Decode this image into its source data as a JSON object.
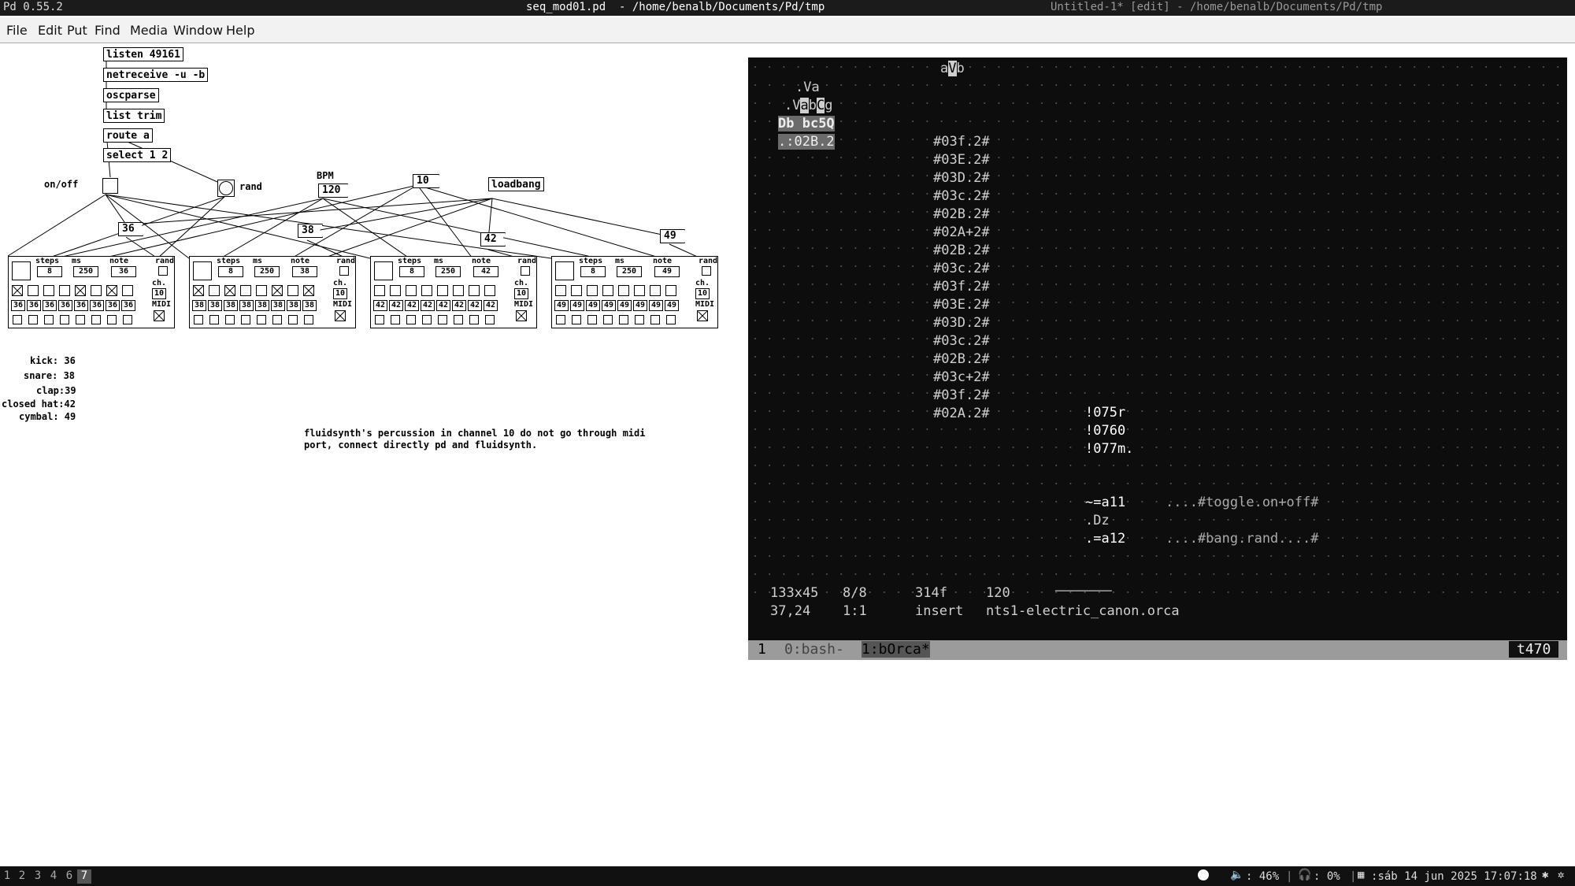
{
  "window": {
    "pd_version": "Pd 0.55.2",
    "active_title": "seq_mod01.pd  - /home/benalb/Documents/Pd/tmp",
    "other_title": "Untitled-1* [edit] - /home/benalb/Documents/Pd/tmp"
  },
  "menu": [
    "File",
    "Edit",
    "Put",
    "Find",
    "Media",
    "Window",
    "Help"
  ],
  "patch": {
    "chain": [
      "listen 49161",
      "netreceive -u -b",
      "oscparse",
      "list trim",
      "route a",
      "select 1 2"
    ],
    "onoff_label": "on/off",
    "rand_label": "rand",
    "bpm_label": "BPM",
    "bpm_value": "120",
    "msg_10": "10",
    "loadbang": "loadbang",
    "note_msgs": [
      "36",
      "38",
      "42",
      "49"
    ],
    "sequencers": [
      {
        "note": "36",
        "steps": "8",
        "ms": "250",
        "ch": "10",
        "notes": [
          "36",
          "36",
          "36",
          "36",
          "36",
          "36",
          "36",
          "36"
        ]
      },
      {
        "note": "38",
        "steps": "8",
        "ms": "250",
        "ch": "10",
        "notes": [
          "38",
          "38",
          "38",
          "38",
          "38",
          "38",
          "38",
          "38"
        ]
      },
      {
        "note": "42",
        "steps": "8",
        "ms": "250",
        "ch": "10",
        "notes": [
          "42",
          "42",
          "42",
          "42",
          "42",
          "42",
          "42",
          "42"
        ]
      },
      {
        "note": "49",
        "steps": "8",
        "ms": "250",
        "ch": "10",
        "notes": [
          "49",
          "49",
          "49",
          "49",
          "49",
          "49",
          "49",
          "49"
        ]
      }
    ],
    "seq_labels": {
      "steps": "steps",
      "ms": "ms",
      "note": "note",
      "rand": "rand",
      "ch": "ch.",
      "midi": "MIDI"
    },
    "drum_map": [
      "kick: 36",
      "snare: 38",
      "clap:39",
      "closed hat:42",
      "cymbal: 49"
    ],
    "comment_line1": "fluidsynth's percussion in channel 10 do not go through midi",
    "comment_line2": "port, connect directly pd and fluidsynth."
  },
  "terminal": {
    "orca_rows": [
      "#03f.2#",
      "#03E.2#",
      "#03D.2#",
      "#03c.2#",
      "#02B.2#",
      "#02A+2#",
      "#02B.2#",
      "#03c.2#",
      "#03f.2#",
      "#03E.2#",
      "#03D.2#",
      "#03c.2#",
      "#02B.2#",
      "#03c+2#",
      "#03f.2#",
      "#02A.2#"
    ],
    "top_ops": {
      "a": "a",
      "V": "V",
      "b": "b"
    },
    "block_ops": {
      "r1": ".Va",
      "r2a": ".V",
      "r2b": "a",
      "r2c": "b",
      "r2d": "C",
      "r2e": "g",
      "r3a": "Db",
      "r3b": " bc5Q",
      "r4a": ".:",
      "r4b": "02B.2"
    },
    "midi_rows": [
      "!075r",
      "!0760",
      "!077m."
    ],
    "osc_rows": [
      {
        "op": "~=a11",
        "comment": "....#toggle.on+off#"
      },
      {
        "op": ".Dz",
        "comment": ""
      },
      {
        "op": ".=a12",
        "comment": "....#bang.rand....#"
      }
    ],
    "status1": [
      "133x45",
      "8/8",
      "314f",
      "120"
    ],
    "status2": [
      "37,24",
      "1:1",
      "insert",
      "nts1-electric_canon.orca"
    ],
    "tmux_left": "1",
    "tmux_win0": "0:bash-",
    "tmux_win1": "1:bOrca*",
    "tmux_right": "t470"
  },
  "taskbar": {
    "workspaces": [
      "1",
      "2",
      "3",
      "4",
      "6",
      "7"
    ],
    "active_ws": "7",
    "volume": "46%",
    "headphones": "0%",
    "datetime": "sáb 14 jun 2025 17:07:18"
  }
}
